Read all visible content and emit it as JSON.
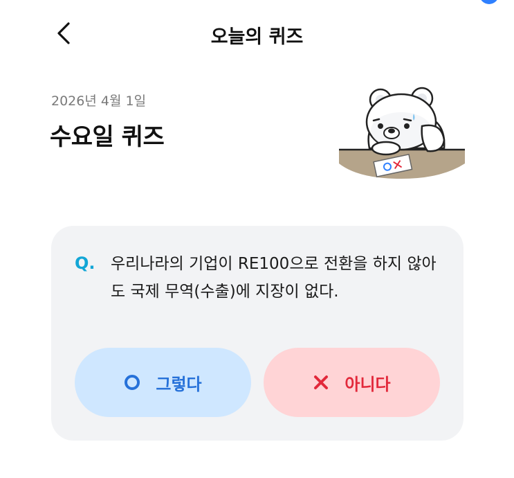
{
  "header": {
    "title": "오늘의 퀴즈",
    "back_icon": "chevron-left-icon"
  },
  "quiz": {
    "date": "2026년 4월 1일",
    "title": "수요일 퀴즈"
  },
  "question": {
    "label": "Q.",
    "text": "우리나라의 기업이 RE100으로 전환을 하지 않아도 국제 무역(수출)에 지장이 없다."
  },
  "answers": {
    "yes": {
      "label": "그렇다",
      "icon": "circle-o-icon"
    },
    "no": {
      "label": "아니다",
      "icon": "x-icon"
    }
  },
  "colors": {
    "accent_blue": "#2f80ff",
    "q_label": "#13a6d6",
    "yes_bg": "#cfe7ff",
    "yes_text": "#2671d9",
    "no_bg": "#ffd4d6",
    "no_text": "#e2293b",
    "card_bg": "#f2f3f5"
  }
}
